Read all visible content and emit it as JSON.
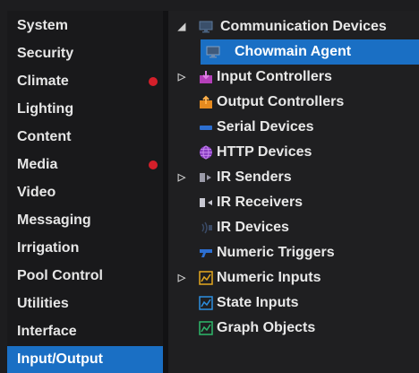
{
  "sidebar": {
    "items": [
      {
        "label": "System"
      },
      {
        "label": "Security"
      },
      {
        "label": "Climate"
      },
      {
        "label": "Lighting"
      },
      {
        "label": "Content"
      },
      {
        "label": "Media"
      },
      {
        "label": "Video"
      },
      {
        "label": "Messaging"
      },
      {
        "label": "Irrigation"
      },
      {
        "label": "Pool Control"
      },
      {
        "label": "Utilities"
      },
      {
        "label": "Interface"
      },
      {
        "label": "Input/Output"
      }
    ],
    "selected": "Input/Output",
    "indicator_color": "#d41f2a",
    "selection_color": "#1a6fc4"
  },
  "tree": {
    "items": [
      {
        "label": "Communication Devices",
        "icon": "monitor-icon",
        "expander": "expanded-triangle-icon"
      },
      {
        "label": "Chowmain Agent",
        "icon": "monitor-icon",
        "selected": true
      },
      {
        "label": "Input Controllers",
        "icon": "input-controller-icon",
        "expander": "collapsed-triangle-icon"
      },
      {
        "label": "Output Controllers",
        "icon": "output-controller-icon"
      },
      {
        "label": "Serial Devices",
        "icon": "serial-cable-icon"
      },
      {
        "label": "HTTP Devices",
        "icon": "globe-icon"
      },
      {
        "label": "IR Senders",
        "icon": "ir-sender-icon",
        "expander": "collapsed-triangle-icon"
      },
      {
        "label": "IR Receivers",
        "icon": "ir-receiver-icon"
      },
      {
        "label": "IR Devices",
        "icon": "ir-device-icon"
      },
      {
        "label": "Numeric Triggers",
        "icon": "numeric-trigger-icon"
      },
      {
        "label": "Numeric Inputs",
        "icon": "numeric-input-icon",
        "expander": "collapsed-triangle-icon"
      },
      {
        "label": "State Inputs",
        "icon": "state-input-icon"
      },
      {
        "label": "Graph Objects",
        "icon": "graph-object-icon"
      }
    ]
  }
}
